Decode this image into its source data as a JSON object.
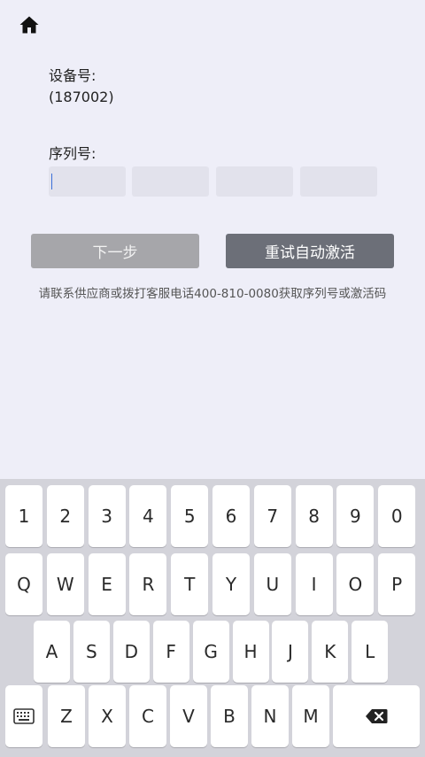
{
  "header": {
    "home_icon": "home-icon"
  },
  "device": {
    "label": "设备号:",
    "value": "(187002)"
  },
  "serial": {
    "label": "序列号:",
    "fields": [
      "",
      "",
      "",
      ""
    ]
  },
  "buttons": {
    "next": "下一步",
    "retry": "重试自动激活"
  },
  "hint": "请联系供应商或拨打客服电话400-810-0080获取序列号或激活码",
  "keyboard": {
    "row1": [
      "1",
      "2",
      "3",
      "4",
      "5",
      "6",
      "7",
      "8",
      "9",
      "0"
    ],
    "row2": [
      "Q",
      "W",
      "E",
      "R",
      "T",
      "Y",
      "U",
      "I",
      "O",
      "P"
    ],
    "row3": [
      "A",
      "S",
      "D",
      "F",
      "G",
      "H",
      "J",
      "K",
      "L"
    ],
    "row4": [
      "Z",
      "X",
      "C",
      "V",
      "B",
      "N",
      "M"
    ],
    "keyboard_icon": "keyboard-toggle-icon",
    "backspace_icon": "backspace-icon"
  }
}
